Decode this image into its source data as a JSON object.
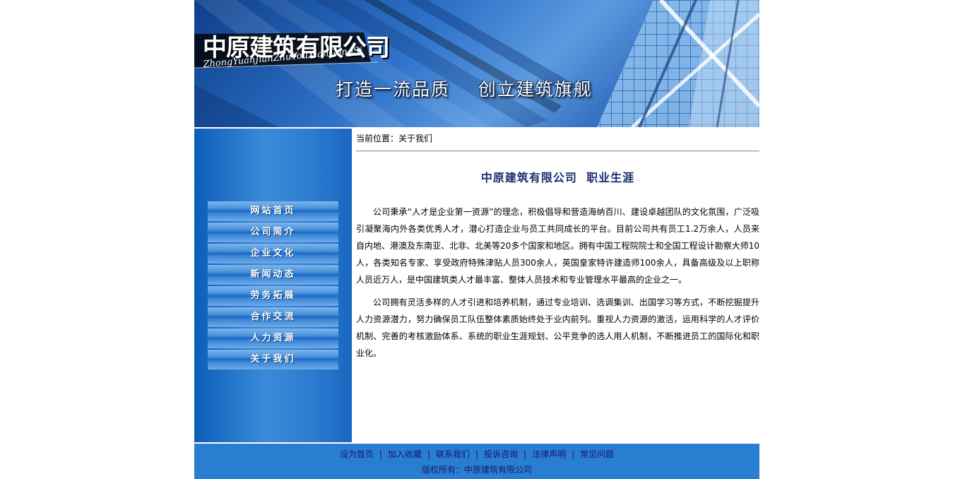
{
  "banner": {
    "company_name": "中原建筑有限公司",
    "company_pinyin": "ZhongYuanJianZhuYouXianGongSi",
    "slogan": "打造一流品质    创立建筑旗舰"
  },
  "nav": {
    "items": [
      {
        "label": "网站首页"
      },
      {
        "label": "公司简介"
      },
      {
        "label": "企业文化"
      },
      {
        "label": "新闻动态"
      },
      {
        "label": "劳务拓展"
      },
      {
        "label": "合作交流"
      },
      {
        "label": "人力资源"
      },
      {
        "label": "关于我们"
      }
    ]
  },
  "content": {
    "breadcrumb": "当前位置：关于我们",
    "title": "中原建筑有限公司  职业生涯",
    "paragraphs": [
      "公司秉承“人才是企业第一资源”的理念，积极倡导和营造海纳百川、建设卓越团队的文化氛围，广泛吸引凝聚海内外各类优秀人才，潜心打造企业与员工共同成长的平台。目前公司共有员工1.2万余人，人员来自内地、港澳及东南亚、北非、北美等20多个国家和地区。拥有中国工程院院士和全国工程设计勘察大师10人，各类知名专家、享受政府特殊津贴人员300余人，英国皇家特许建造师100余人，具备高级及以上职称人员近万人，是中国建筑类人才最丰富、整体人员技术和专业管理水平最高的企业之一。",
      "公司拥有灵活多样的人才引进和培养机制，通过专业培训、选调集训、出国学习等方式，不断挖掘提升人力资源潜力，努力确保员工队伍整体素质始终处于业内前列。重视人力资源的激活，运用科学的人才评价机制、完善的考核激励体系、系统的职业生涯规划、公平竞争的选人用人机制，不断推进员工的国际化和职业化。"
    ]
  },
  "footer": {
    "links": [
      "设为首页",
      "加入收藏",
      "联系我们",
      "投诉咨询",
      "法律声明",
      "常见问题"
    ],
    "separator": "|",
    "copyright": "版权所有：中原建筑有限公司"
  },
  "colors": {
    "sidebar_blue": "#2c7bd0",
    "footer_blue": "#2a7ed1",
    "title_navy": "#1b2d6e"
  }
}
